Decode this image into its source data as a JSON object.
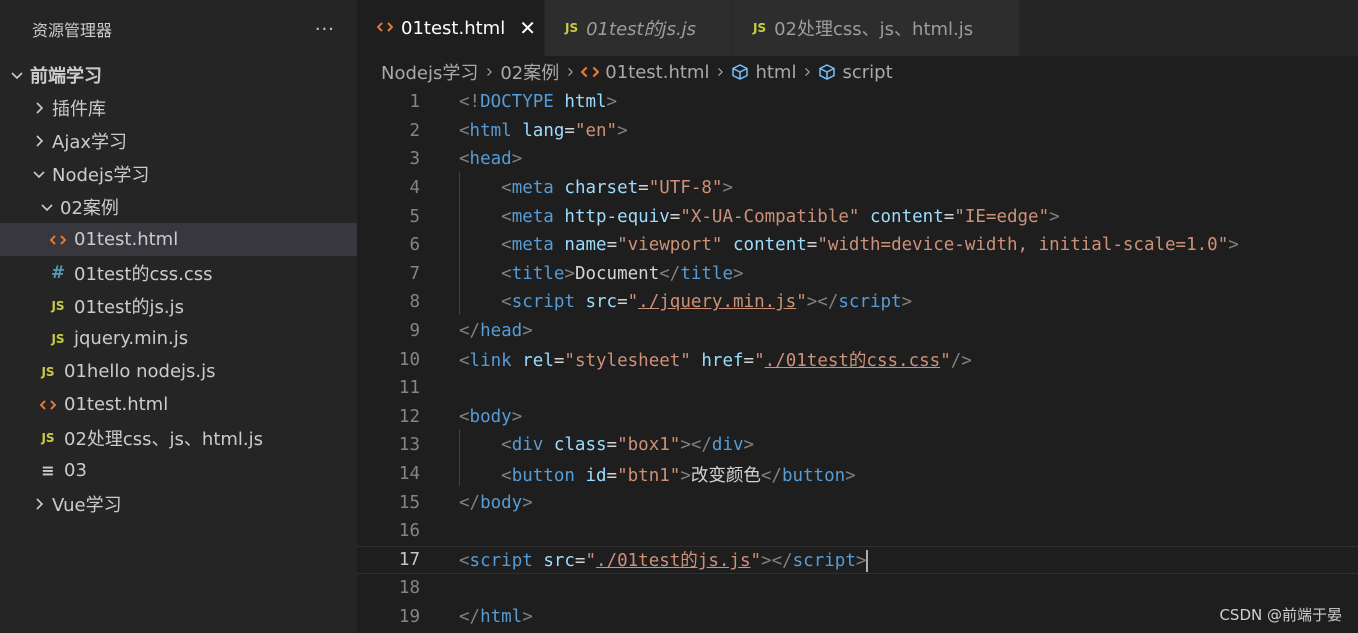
{
  "sidebar": {
    "title": "资源管理器",
    "more": "···",
    "tree": [
      {
        "label": "前端学习",
        "indent": 0,
        "twisty": "down",
        "icon": "",
        "bold": true
      },
      {
        "label": "插件库",
        "indent": 1,
        "twisty": "right",
        "icon": ""
      },
      {
        "label": "Ajax学习",
        "indent": 1,
        "twisty": "right",
        "icon": ""
      },
      {
        "label": "Nodejs学习",
        "indent": 1,
        "twisty": "down",
        "icon": ""
      },
      {
        "label": "02案例",
        "indent": 2,
        "twisty": "down",
        "icon": ""
      },
      {
        "label": "01test.html",
        "indent": 3,
        "twisty": "",
        "icon": "html",
        "selected": true
      },
      {
        "label": "01test的css.css",
        "indent": 3,
        "twisty": "",
        "icon": "css"
      },
      {
        "label": "01test的js.js",
        "indent": 3,
        "twisty": "",
        "icon": "js"
      },
      {
        "label": "jquery.min.js",
        "indent": 3,
        "twisty": "",
        "icon": "js"
      },
      {
        "label": "01hello nodejs.js",
        "indent": 2,
        "twisty": "",
        "icon": "js"
      },
      {
        "label": "01test.html",
        "indent": 2,
        "twisty": "",
        "icon": "html"
      },
      {
        "label": "02处理css、js、html.js",
        "indent": 2,
        "twisty": "",
        "icon": "js"
      },
      {
        "label": "03",
        "indent": 2,
        "twisty": "",
        "icon": "txt"
      },
      {
        "label": "Vue学习",
        "indent": 1,
        "twisty": "right",
        "icon": ""
      }
    ],
    "icon_glyphs": {
      "js": "JS",
      "css": "#",
      "txt": "≡"
    }
  },
  "tabs": [
    {
      "label": "01test.html",
      "icon": "html",
      "active": true,
      "close": "✕"
    },
    {
      "label": "01test的js.js",
      "icon": "js",
      "italic": true,
      "icon_text": "JS"
    },
    {
      "label": "02处理css、js、html.js",
      "icon": "js",
      "icon_text": "JS"
    }
  ],
  "breadcrumb": {
    "parts": [
      "Nodejs学习",
      "02案例",
      "01test.html",
      "html",
      "script"
    ]
  },
  "editor": {
    "current_line": 17,
    "lines": [
      {
        "n": "1",
        "tokens": [
          [
            "p",
            "<!"
          ],
          [
            "t",
            "DOCTYPE"
          ],
          [
            "x",
            " "
          ],
          [
            "a",
            "html"
          ],
          [
            "p",
            ">"
          ]
        ]
      },
      {
        "n": "2",
        "tokens": [
          [
            "p",
            "<"
          ],
          [
            "t",
            "html"
          ],
          [
            "x",
            " "
          ],
          [
            "a",
            "lang"
          ],
          [
            "x",
            "="
          ],
          [
            "s",
            "\"en\""
          ],
          [
            "p",
            ">"
          ]
        ]
      },
      {
        "n": "3",
        "tokens": [
          [
            "p",
            "<"
          ],
          [
            "t",
            "head"
          ],
          [
            "p",
            ">"
          ]
        ]
      },
      {
        "n": "4",
        "tokens": [
          [
            "x",
            "    "
          ],
          [
            "p",
            "<"
          ],
          [
            "t",
            "meta"
          ],
          [
            "x",
            " "
          ],
          [
            "a",
            "charset"
          ],
          [
            "x",
            "="
          ],
          [
            "s",
            "\"UTF-8\""
          ],
          [
            "p",
            ">"
          ]
        ]
      },
      {
        "n": "5",
        "tokens": [
          [
            "x",
            "    "
          ],
          [
            "p",
            "<"
          ],
          [
            "t",
            "meta"
          ],
          [
            "x",
            " "
          ],
          [
            "a",
            "http-equiv"
          ],
          [
            "x",
            "="
          ],
          [
            "s",
            "\"X-UA-Compatible\""
          ],
          [
            "x",
            " "
          ],
          [
            "a",
            "content"
          ],
          [
            "x",
            "="
          ],
          [
            "s",
            "\"IE=edge\""
          ],
          [
            "p",
            ">"
          ]
        ]
      },
      {
        "n": "6",
        "tokens": [
          [
            "x",
            "    "
          ],
          [
            "p",
            "<"
          ],
          [
            "t",
            "meta"
          ],
          [
            "x",
            " "
          ],
          [
            "a",
            "name"
          ],
          [
            "x",
            "="
          ],
          [
            "s",
            "\"viewport\""
          ],
          [
            "x",
            " "
          ],
          [
            "a",
            "content"
          ],
          [
            "x",
            "="
          ],
          [
            "s",
            "\"width=device-width, initial-scale=1.0\""
          ],
          [
            "p",
            ">"
          ]
        ]
      },
      {
        "n": "7",
        "tokens": [
          [
            "x",
            "    "
          ],
          [
            "p",
            "<"
          ],
          [
            "t",
            "title"
          ],
          [
            "p",
            ">"
          ],
          [
            "x",
            "Document"
          ],
          [
            "p",
            "</"
          ],
          [
            "t",
            "title"
          ],
          [
            "p",
            ">"
          ]
        ]
      },
      {
        "n": "8",
        "tokens": [
          [
            "x",
            "    "
          ],
          [
            "p",
            "<"
          ],
          [
            "t",
            "script"
          ],
          [
            "x",
            " "
          ],
          [
            "a",
            "src"
          ],
          [
            "x",
            "="
          ],
          [
            "s",
            "\""
          ],
          [
            "su",
            "./jquery.min.js"
          ],
          [
            "s",
            "\""
          ],
          [
            "p",
            "></"
          ],
          [
            "t",
            "script"
          ],
          [
            "p",
            ">"
          ]
        ]
      },
      {
        "n": "9",
        "tokens": [
          [
            "p",
            "</"
          ],
          [
            "t",
            "head"
          ],
          [
            "p",
            ">"
          ]
        ]
      },
      {
        "n": "10",
        "tokens": [
          [
            "p",
            "<"
          ],
          [
            "t",
            "link"
          ],
          [
            "x",
            " "
          ],
          [
            "a",
            "rel"
          ],
          [
            "x",
            "="
          ],
          [
            "s",
            "\"stylesheet\""
          ],
          [
            "x",
            " "
          ],
          [
            "a",
            "href"
          ],
          [
            "x",
            "="
          ],
          [
            "s",
            "\""
          ],
          [
            "su",
            "./01test的css.css"
          ],
          [
            "s",
            "\""
          ],
          [
            "p",
            "/>"
          ]
        ]
      },
      {
        "n": "11",
        "tokens": []
      },
      {
        "n": "12",
        "tokens": [
          [
            "p",
            "<"
          ],
          [
            "t",
            "body"
          ],
          [
            "p",
            ">"
          ]
        ]
      },
      {
        "n": "13",
        "tokens": [
          [
            "x",
            "    "
          ],
          [
            "p",
            "<"
          ],
          [
            "t",
            "div"
          ],
          [
            "x",
            " "
          ],
          [
            "a",
            "class"
          ],
          [
            "x",
            "="
          ],
          [
            "s",
            "\"box1\""
          ],
          [
            "p",
            "></"
          ],
          [
            "t",
            "div"
          ],
          [
            "p",
            ">"
          ]
        ]
      },
      {
        "n": "14",
        "tokens": [
          [
            "x",
            "    "
          ],
          [
            "p",
            "<"
          ],
          [
            "t",
            "button"
          ],
          [
            "x",
            " "
          ],
          [
            "a",
            "id"
          ],
          [
            "x",
            "="
          ],
          [
            "s",
            "\"btn1\""
          ],
          [
            "p",
            ">"
          ],
          [
            "x",
            "改变颜色"
          ],
          [
            "p",
            "</"
          ],
          [
            "t",
            "button"
          ],
          [
            "p",
            ">"
          ]
        ]
      },
      {
        "n": "15",
        "tokens": [
          [
            "p",
            "</"
          ],
          [
            "t",
            "body"
          ],
          [
            "p",
            ">"
          ]
        ]
      },
      {
        "n": "16",
        "tokens": []
      },
      {
        "n": "17",
        "tokens": [
          [
            "p",
            "<"
          ],
          [
            "t",
            "script"
          ],
          [
            "x",
            " "
          ],
          [
            "a",
            "src"
          ],
          [
            "x",
            "="
          ],
          [
            "s",
            "\""
          ],
          [
            "su",
            "./01test的js.js"
          ],
          [
            "s",
            "\""
          ],
          [
            "p",
            "></"
          ],
          [
            "t",
            "script"
          ],
          [
            "p",
            ">"
          ]
        ],
        "cursor": true
      },
      {
        "n": "18",
        "tokens": []
      },
      {
        "n": "19",
        "tokens": [
          [
            "p",
            "</"
          ],
          [
            "t",
            "html"
          ],
          [
            "p",
            ">"
          ]
        ]
      }
    ]
  },
  "watermark": "CSDN @前端于晏",
  "colors": {
    "tag": "#569cd6",
    "attr": "#9cdcfe",
    "string": "#ce9178",
    "punct": "#808080",
    "js_icon": "#cbcb41",
    "html_icon": "#e37933",
    "css_icon": "#519aba"
  }
}
